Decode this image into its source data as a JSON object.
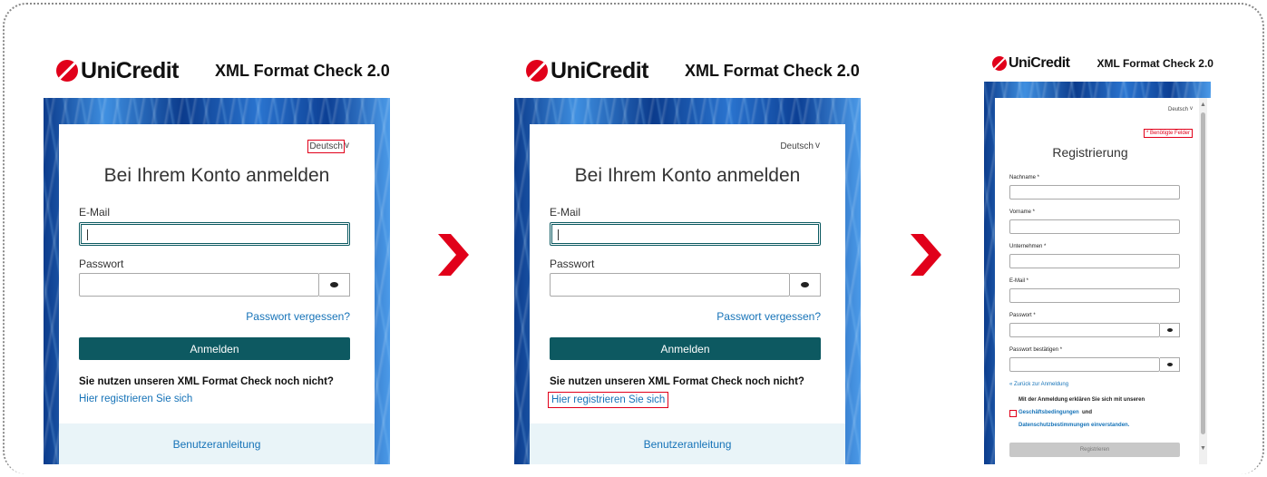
{
  "brand": {
    "logo_text": "UniCredit",
    "app_title": "XML Format Check 2.0",
    "accent": "#e1001a",
    "primary_button": "#0d5961",
    "link_color": "#1673b8"
  },
  "login": {
    "language": "Deutsch",
    "language_chevron": "v",
    "title": "Bei Ihrem Konto anmelden",
    "email_label": "E-Mail",
    "password_label": "Passwort",
    "password_toggle_icon": "eye-icon",
    "forgot_link": "Passwort vergessen?",
    "login_button": "Anmelden",
    "question": "Sie nutzen unseren XML Format Check noch nicht?",
    "register_link": "Hier registrieren Sie sich",
    "footer_link": "Benutzeranleitung"
  },
  "register": {
    "language": "Deutsch",
    "language_chevron": "v",
    "required_note": "* Benötigte Felder",
    "title": "Registrierung",
    "fields": [
      {
        "label": "Nachname *",
        "has_eye": false
      },
      {
        "label": "Vorname *",
        "has_eye": false
      },
      {
        "label": "Unternehmen *",
        "has_eye": false
      },
      {
        "label": "E-Mail *",
        "has_eye": false
      },
      {
        "label": "Passwort *",
        "has_eye": true
      },
      {
        "label": "Passwort bestätigen *",
        "has_eye": true
      }
    ],
    "back_link": "« Zurück zur Anmeldung",
    "consent_text_1": "Mit der Anmeldung erklären Sie sich mit unseren",
    "consent_link_1": "Geschäftsbedingungen",
    "consent_text_2": " und",
    "consent_link_2": "Datenschutzbestimmungen einverstanden.",
    "submit_button": "Registrieren",
    "scroll_up_icon": "triangle-up-icon",
    "scroll_down_icon": "triangle-down-icon"
  },
  "steps": {
    "arrow_icon": "chevron-right-icon",
    "arrow_color": "#e1001a"
  }
}
